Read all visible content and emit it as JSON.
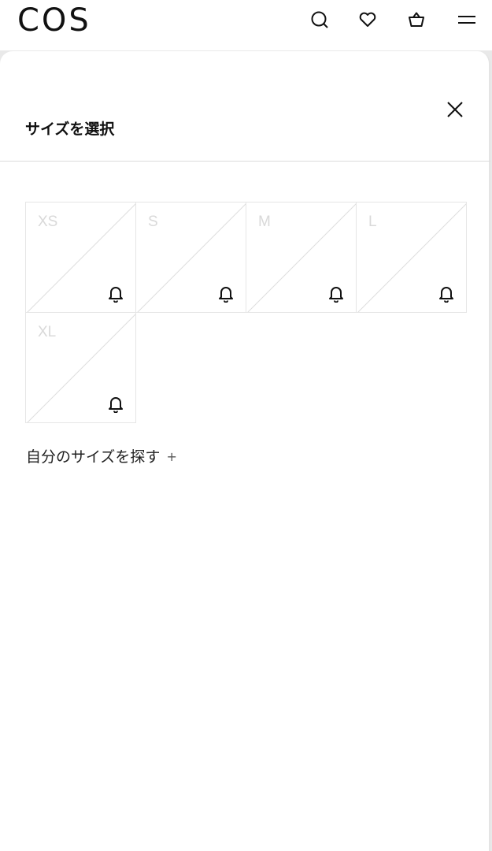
{
  "header": {
    "logo": "COS",
    "icons": [
      "search-icon",
      "heart-icon",
      "bag-icon",
      "menu-icon"
    ]
  },
  "sheet": {
    "title": "サイズを選択",
    "close_icon": "close-icon"
  },
  "sizes": [
    {
      "label": "XS",
      "available": false,
      "notify_icon": "bell-icon"
    },
    {
      "label": "S",
      "available": false,
      "notify_icon": "bell-icon"
    },
    {
      "label": "M",
      "available": false,
      "notify_icon": "bell-icon"
    },
    {
      "label": "L",
      "available": false,
      "notify_icon": "bell-icon"
    },
    {
      "label": "XL",
      "available": false,
      "notify_icon": "bell-icon"
    }
  ],
  "find_size": {
    "label": "自分のサイズを探す",
    "expand_symbol": "+"
  },
  "colors": {
    "text": "#111111",
    "disabled_label": "#d9d9d9",
    "cell_border": "#e6e6e6"
  }
}
